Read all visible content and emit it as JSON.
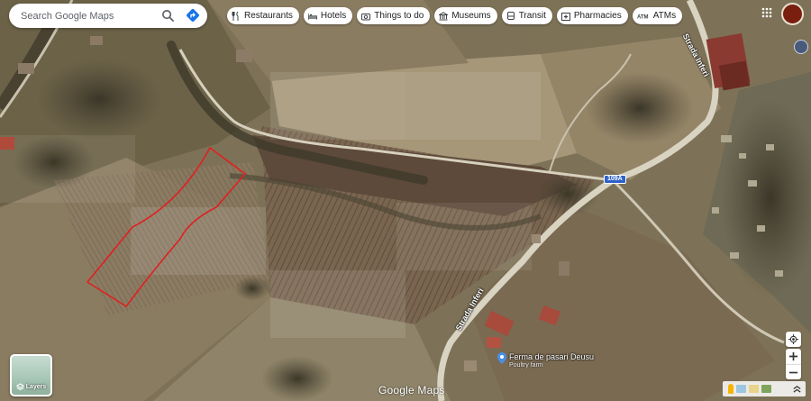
{
  "search": {
    "placeholder": "Search Google Maps"
  },
  "chips": [
    {
      "label": "Restaurants",
      "icon": "fork-knife-icon"
    },
    {
      "label": "Hotels",
      "icon": "bed-icon"
    },
    {
      "label": "Things to do",
      "icon": "camera-icon"
    },
    {
      "label": "Museums",
      "icon": "museum-icon"
    },
    {
      "label": "Transit",
      "icon": "bus-icon"
    },
    {
      "label": "Pharmacies",
      "icon": "pharmacy-icon"
    },
    {
      "label": "ATMs",
      "icon": "atm-icon"
    }
  ],
  "map": {
    "road_labels": [
      "Strada Inferi",
      "Strada Inferi"
    ],
    "road_badge": "109A",
    "poi": {
      "name": "Ferma de pasari Deusu",
      "type": "Poultry farm"
    },
    "watermark": "Google Maps",
    "outline_color": "#e02020"
  },
  "layers": {
    "label": "Layers"
  }
}
